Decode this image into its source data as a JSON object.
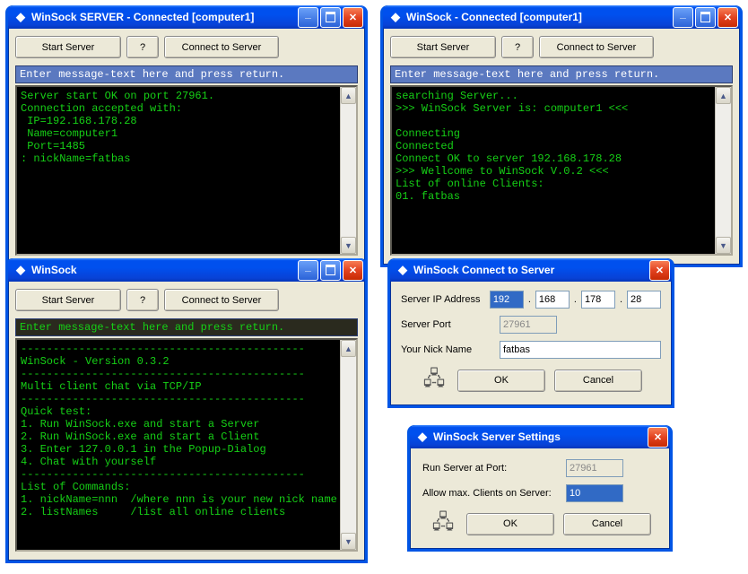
{
  "win1": {
    "title": "WinSock SERVER - Connected [computer1]",
    "start_btn": "Start Server",
    "help_btn": "?",
    "connect_btn": "Connect to Server",
    "msg_prompt": "Enter message-text here and press return.",
    "console": "Server start OK on port 27961.\nConnection accepted with:\n IP=192.168.178.28\n Name=computer1\n Port=1485\n: nickName=fatbas"
  },
  "win2": {
    "title": "WinSock - Connected [computer1]",
    "start_btn": "Start Server",
    "help_btn": "?",
    "connect_btn": "Connect to Server",
    "msg_prompt": "Enter message-text here and press return.",
    "console": "searching Server...\n>>> WinSock Server is: computer1 <<<\n\nConnecting\nConnected\nConnect OK to server 192.168.178.28\n>>> Wellcome to WinSock V.0.2 <<<\nList of online Clients:\n01. fatbas"
  },
  "win3": {
    "title": "WinSock",
    "start_btn": "Start Server",
    "help_btn": "?",
    "connect_btn": "Connect to Server",
    "msg_prompt": "Enter message-text here and press return.",
    "console": "--------------------------------------------\nWinSock - Version 0.3.2\n--------------------------------------------\nMulti client chat via TCP/IP\n--------------------------------------------\nQuick test:\n1. Run WinSock.exe and start a Server\n2. Run WinSock.exe and start a Client\n3. Enter 127.0.0.1 in the Popup-Dialog\n4. Chat with yourself\n--------------------------------------------\nList of Commands:\n1. nickName=nnn  /where nnn is your new nick name\n2. listNames     /list all online clients"
  },
  "dlg_connect": {
    "title": "WinSock Connect to Server",
    "ip_label": "Server IP Address",
    "ip": [
      "192",
      "168",
      "178",
      "28"
    ],
    "port_label": "Server Port",
    "port": "27961",
    "nick_label": "Your Nick Name",
    "nick": "fatbas",
    "ok": "OK",
    "cancel": "Cancel"
  },
  "dlg_settings": {
    "title": "WinSock Server Settings",
    "port_label": "Run Server at Port:",
    "port": "27961",
    "max_label": "Allow max. Clients on Server:",
    "max": "10",
    "ok": "OK",
    "cancel": "Cancel"
  }
}
